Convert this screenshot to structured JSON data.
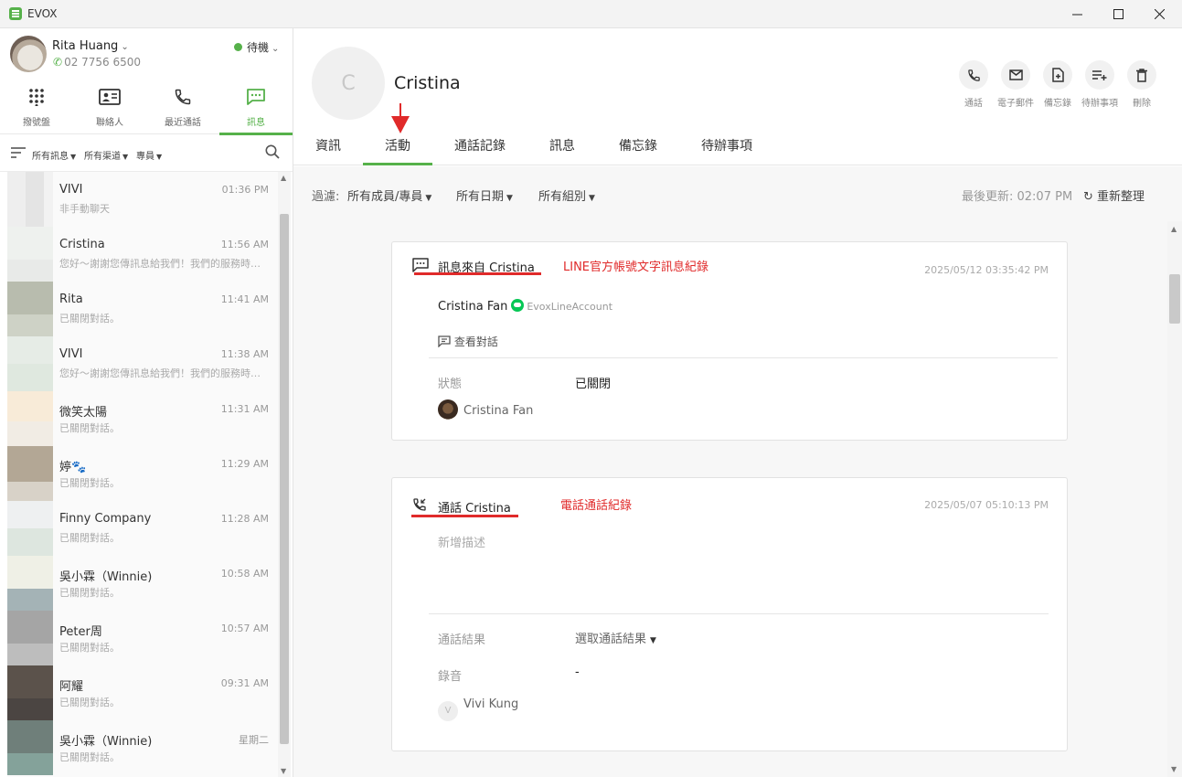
{
  "app": {
    "title": "EVOX",
    "accent": "#56b14a",
    "annotation_color": "#e02a2a"
  },
  "window_controls": [
    "minimize-icon",
    "maximize-icon",
    "close-icon"
  ],
  "profile": {
    "name": "Rita Huang",
    "phone": "02 7756 6500",
    "status": "待機"
  },
  "nav": {
    "items": [
      {
        "label": "撥號盤",
        "icon": "dialpad-icon"
      },
      {
        "label": "聯絡人",
        "icon": "contact-card-icon"
      },
      {
        "label": "最近通話",
        "icon": "phone-icon"
      },
      {
        "label": "訊息",
        "icon": "chat-icon",
        "active": true
      }
    ]
  },
  "filters": {
    "all_messages": "所有訊息",
    "all_channels": "所有渠道",
    "agent": "專員"
  },
  "conversations": [
    {
      "name": "VIVI",
      "time": "01:36 PM",
      "preview": "非手動聊天"
    },
    {
      "name": "Cristina",
      "time": "11:56 AM",
      "preview": "您好～謝謝您傳訊息給我們！我們的服務時間為週一至週五"
    },
    {
      "name": "Rita",
      "time": "11:41 AM",
      "preview": "已關閉對話。"
    },
    {
      "name": "VIVI",
      "time": "11:38 AM",
      "preview": "您好～謝謝您傳訊息給我們！我們的服務時間為週一至週五"
    },
    {
      "name": "微笑太陽",
      "time": "11:31 AM",
      "preview": "已關閉對話。"
    },
    {
      "name": "婷🐾",
      "time": "11:29 AM",
      "preview": "已關閉對話。"
    },
    {
      "name": "Finny Company",
      "time": "11:28 AM",
      "preview": "已關閉對話。"
    },
    {
      "name": "吳小霖（Winnie)",
      "time": "10:58 AM",
      "preview": "已關閉對話。"
    },
    {
      "name": "Peter周",
      "time": "10:57 AM",
      "preview": "已關閉對話。"
    },
    {
      "name": "阿耀",
      "time": "09:31 AM",
      "preview": "已關閉對話。"
    },
    {
      "name": "吳小霖（Winnie)",
      "time": "星期二",
      "preview": "已關閉對話。"
    }
  ],
  "contact": {
    "initial": "C",
    "name": "Cristina"
  },
  "actions": [
    {
      "label": "通話",
      "icon": "phone-icon"
    },
    {
      "label": "電子郵件",
      "icon": "mail-icon"
    },
    {
      "label": "備忘錄",
      "icon": "note-add-icon"
    },
    {
      "label": "待辦事項",
      "icon": "todo-add-icon"
    },
    {
      "label": "刪除",
      "icon": "trash-icon"
    }
  ],
  "tabs": [
    {
      "label": "資訊"
    },
    {
      "label": "活動",
      "active": true
    },
    {
      "label": "通話記錄"
    },
    {
      "label": "訊息"
    },
    {
      "label": "備忘錄"
    },
    {
      "label": "待辦事項"
    }
  ],
  "toolbar": {
    "filter_label": "過濾:",
    "members": "所有成員/專員",
    "dates": "所有日期",
    "groups": "所有組別",
    "last_updated": "最後更新: 02:07 PM",
    "refresh": "重新整理"
  },
  "cards": {
    "message": {
      "title": "訊息來自 Cristina",
      "annotation": "LINE官方帳號文字訊息紀錄",
      "date": "2025/05/12 03:35:42 PM",
      "sender": "Cristina Fan",
      "channel": "EvoxLineAccount",
      "view_link": "查看對話",
      "status_label": "狀態",
      "status_value": "已關閉",
      "agent": "Cristina Fan"
    },
    "call": {
      "title": "通話 Cristina",
      "annotation": "電話通話紀錄",
      "date": "2025/05/07 05:10:13 PM",
      "description_placeholder": "新增描述",
      "result_label": "通話結果",
      "result_value": "選取通話結果",
      "recording_label": "錄音",
      "recording_value": "-",
      "agent_initial": "V",
      "agent": "Vivi Kung"
    }
  }
}
